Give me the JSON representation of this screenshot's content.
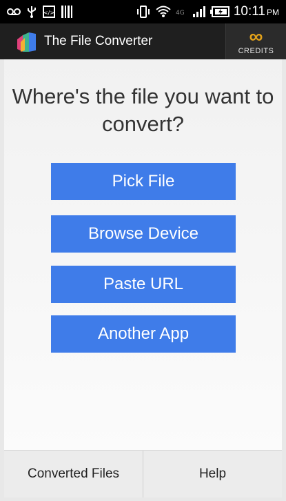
{
  "status_bar": {
    "left_icons": [
      "voicemail-icon",
      "usb-icon",
      "debug-icon",
      "barcode-icon"
    ],
    "right_icons": [
      "vibrate-icon",
      "wifi-icon",
      "4g-icon",
      "signal-icon",
      "battery-charging-icon"
    ],
    "time": "10:11",
    "ampm": "PM"
  },
  "action_bar": {
    "title": "The File Converter",
    "credits_value": "∞",
    "credits_label": "CREDITS"
  },
  "main": {
    "question": "Where's the file you want to convert?",
    "buttons": [
      {
        "label": "Pick File"
      },
      {
        "label": "Browse Device"
      },
      {
        "label": "Paste URL"
      },
      {
        "label": "Another App"
      }
    ]
  },
  "bottom_bar": {
    "left_label": "Converted Files",
    "right_label": "Help"
  },
  "colors": {
    "button_blue": "#3f7ce9",
    "credits_gold": "#e3a21a",
    "action_bar": "#1f1f1f"
  }
}
